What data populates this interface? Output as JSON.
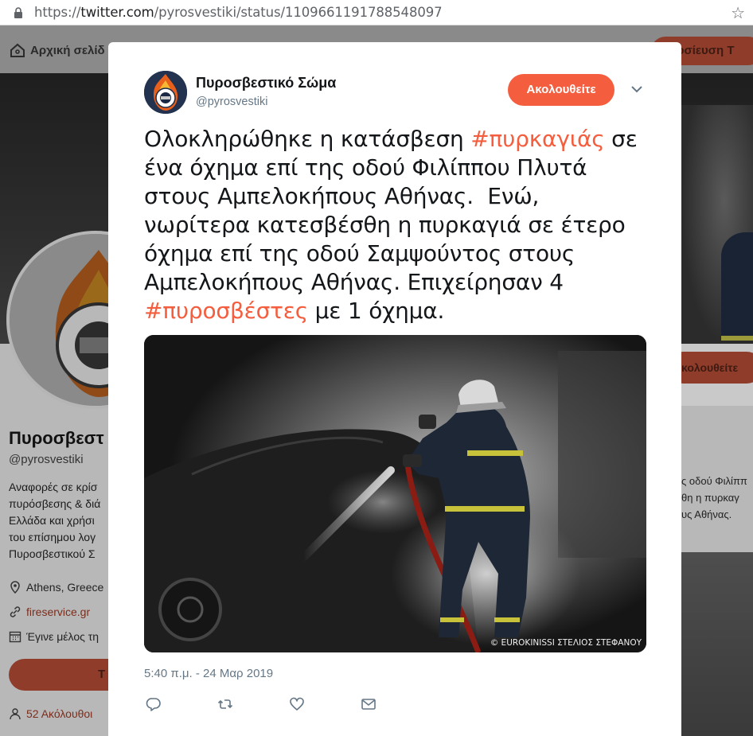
{
  "browser": {
    "url_scheme": "https://",
    "url_host": "twitter.com",
    "url_path": "/pyrosvestiki/status/1109661191788548097"
  },
  "background": {
    "nav_home": "Αρχική σελίδ",
    "nav_tweet_button": "ημοσίευση Τ",
    "profile_name": "Πυροσβεστ",
    "profile_handle": "@pyrosvestiki",
    "bio_lines": [
      "Αναφορές σε κρίσ",
      "πυρόσβεσης & διά",
      "Ελλάδα και χρήσι",
      "του επίσημου λογ",
      "Πυροσβεστικού Σ"
    ],
    "location": "Athens, Greece",
    "website": "fireservice.gr",
    "joined": "Έγινε μέλος τη",
    "left_button": "Τ",
    "followers": "52 Ακόλουθοι",
    "right_follow_button": "κολουθείτε",
    "right_text_lines": [
      "ς οδού Φιλίππ",
      "θη η πυρκαγ",
      "υς Αθήνας."
    ]
  },
  "tweet": {
    "author_name": "Πυροσβεστικό Σώμα",
    "author_handle": "@pyrosvestiki",
    "follow_label": "Ακολουθείτε",
    "text_lines": [
      {
        "pre": "Ολοκληρώθηκε η κατάσβεση ",
        "tag": "#πυρκαγιάς",
        "post": " σε"
      },
      {
        "pre": "ένα όχημα επί της οδού Φιλίππου Πλυτά",
        "tag": "",
        "post": ""
      },
      {
        "pre": "στους Αμπελοκήπους Αθήνας.  Ενώ,",
        "tag": "",
        "post": ""
      },
      {
        "pre": "νωρίτερα κατεσβέσθη η πυρκαγιά σε έτερο",
        "tag": "",
        "post": ""
      },
      {
        "pre": "όχημα επί της οδού Σαμψούντος στους",
        "tag": "",
        "post": ""
      },
      {
        "pre": "Αμπελοκήπους Αθήνας. Επιχείρησαν 4",
        "tag": "",
        "post": ""
      },
      {
        "pre": "",
        "tag": "#πυροσβέστες",
        "post": " με 1 όχημα."
      }
    ],
    "photo_credit": "©  EUROKINISSI ΣΤΕΛΙΟΣ ΣΤΕΦΑΝΟΥ",
    "timestamp": "5:40 π.μ. - 24 Μαρ 2019",
    "accent_color": "#f45d3d",
    "actions": [
      "reply-icon",
      "retweet-icon",
      "like-icon",
      "message-icon"
    ]
  }
}
